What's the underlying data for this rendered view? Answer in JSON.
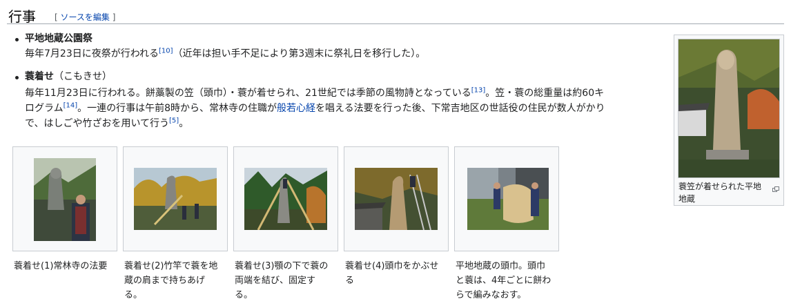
{
  "heading": {
    "title": "行事",
    "edit_open": "[ ",
    "edit_link": "ソースを編集",
    "edit_close": " ]"
  },
  "items": [
    {
      "term": "平地地蔵公園祭",
      "text_a": "毎年7月23日に夜祭が行われる",
      "ref1": "[10]",
      "text_b": "（近年は担い手不足により第3週末に祭礼日を移行した）。"
    },
    {
      "term": "蓑着せ",
      "term_suffix": "（こもきせ）",
      "line1_a": "毎年11月23日に行われる。餅藁製の笠（頭巾）・蓑が着せられ、21世紀では季節の風物詩となっている",
      "ref13": "[13]",
      "line1_b": "。笠・蓑の総重量は約60キ",
      "line2_a": "ログラム",
      "ref14": "[14]",
      "line2_b": "。一連の行事は午前8時から、常林寺の住職が",
      "link": "般若心経",
      "line2_c": "を唱える法要を行った後、下常吉地区の世話役の住民が数人がかり",
      "line3_a": "で、はしごや竹ざおを用いて行う",
      "ref5": "[5]",
      "line3_b": "。"
    }
  ],
  "gallery": [
    {
      "caption": "蓑着せ(1)常林寺の法要",
      "image": "photo-memorial-service"
    },
    {
      "caption": "蓑着せ(2)竹竿で蓑を地蔵の肩まで持ちあげる。",
      "image": "photo-lifting-straw-cape"
    },
    {
      "caption": "蓑着せ(3)顎の下で蓑の両端を結び、固定する。",
      "image": "photo-tying-cape"
    },
    {
      "caption": "蓑着せ(4)頭巾をかぶせる",
      "image": "photo-placing-hood"
    },
    {
      "caption": "平地地蔵の頭巾。頭巾と蓑は、4年ごとに餅わらで編みなおす。",
      "image": "photo-straw-hood"
    }
  ],
  "side_image": {
    "caption": "蓑笠が着せられた平地地蔵",
    "image": "photo-jizo-in-straw",
    "enlarge_icon": "magnify-icon"
  },
  "colors": {
    "link": "#0645ad",
    "text": "#202122",
    "border": "#a2a9b1",
    "thumb_bg": "#f8f9fa"
  }
}
